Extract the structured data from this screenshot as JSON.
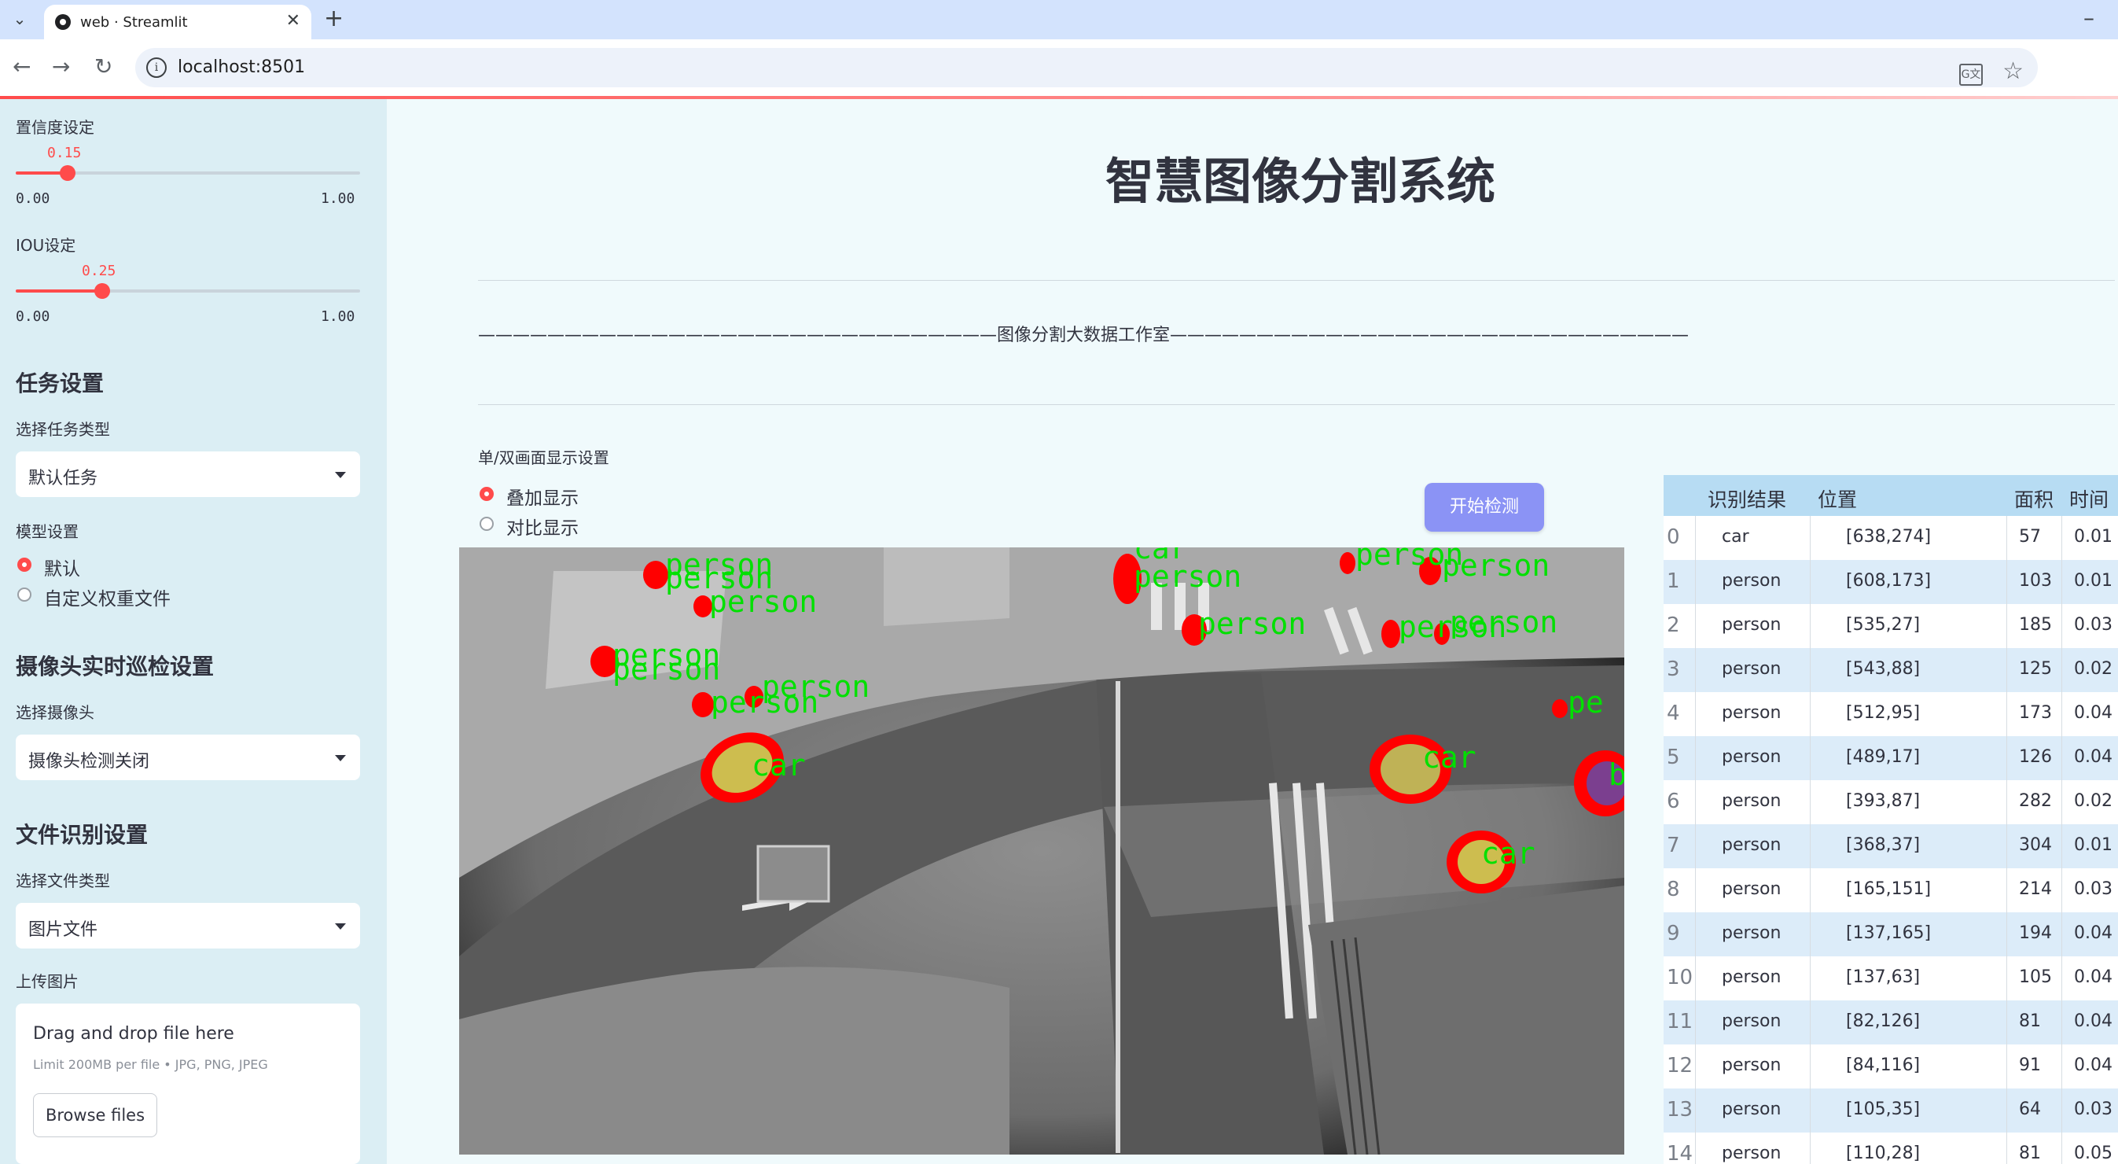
{
  "browser": {
    "tab_title": "web · Streamlit",
    "url": "localhost:8501"
  },
  "sidebar": {
    "confidence": {
      "label": "置信度设定",
      "value": "0.15",
      "value_num": 0.15,
      "min": "0.00",
      "max": "1.00"
    },
    "iou": {
      "label": "IOU设定",
      "value": "0.25",
      "value_num": 0.25,
      "min": "0.00",
      "max": "1.00"
    },
    "task_heading": "任务设置",
    "task_type_label": "选择任务类型",
    "task_type_value": "默认任务",
    "model_label": "模型设置",
    "model_options": [
      "默认",
      "自定义权重文件"
    ],
    "model_selected": "默认",
    "camera_heading": "摄像头实时巡检设置",
    "camera_label": "选择摄像头",
    "camera_value": "摄像头检测关闭",
    "file_heading": "文件识别设置",
    "file_type_label": "选择文件类型",
    "file_type_value": "图片文件",
    "upload_label": "上传图片",
    "uploader": {
      "main": "Drag and drop file here",
      "sub": "Limit 200MB per file • JPG, PNG, JPEG",
      "button": "Browse files"
    }
  },
  "main": {
    "title": "智慧图像分割系统",
    "banner": "——————————————————————————————图像分割大数据工作室——————————————————————————————",
    "display_mode_label": "单/双画面显示设置",
    "display_modes": [
      "叠加显示",
      "对比显示"
    ],
    "display_selected": "叠加显示",
    "start_button": "开始检测"
  },
  "detections_overlay": [
    "person",
    "person",
    "person",
    "person",
    "person",
    "person",
    "person",
    "person",
    "car",
    "person",
    "person",
    "pe",
    "car",
    "car",
    "b"
  ],
  "results_table": {
    "columns": [
      "识别结果",
      "位置",
      "面积",
      "时间"
    ],
    "rows": [
      {
        "idx": "0",
        "cls": "car",
        "pos": "[638,274]",
        "area": "57",
        "time": "0.01"
      },
      {
        "idx": "1",
        "cls": "person",
        "pos": "[608,173]",
        "area": "103",
        "time": "0.01"
      },
      {
        "idx": "2",
        "cls": "person",
        "pos": "[535,27]",
        "area": "185",
        "time": "0.03"
      },
      {
        "idx": "3",
        "cls": "person",
        "pos": "[543,88]",
        "area": "125",
        "time": "0.02"
      },
      {
        "idx": "4",
        "cls": "person",
        "pos": "[512,95]",
        "area": "173",
        "time": "0.04"
      },
      {
        "idx": "5",
        "cls": "person",
        "pos": "[489,17]",
        "area": "126",
        "time": "0.04"
      },
      {
        "idx": "6",
        "cls": "person",
        "pos": "[393,87]",
        "area": "282",
        "time": "0.02"
      },
      {
        "idx": "7",
        "cls": "person",
        "pos": "[368,37]",
        "area": "304",
        "time": "0.01"
      },
      {
        "idx": "8",
        "cls": "person",
        "pos": "[165,151]",
        "area": "214",
        "time": "0.03"
      },
      {
        "idx": "9",
        "cls": "person",
        "pos": "[137,165]",
        "area": "194",
        "time": "0.04"
      },
      {
        "idx": "10",
        "cls": "person",
        "pos": "[137,63]",
        "area": "105",
        "time": "0.04"
      },
      {
        "idx": "11",
        "cls": "person",
        "pos": "[82,126]",
        "area": "81",
        "time": "0.04"
      },
      {
        "idx": "12",
        "cls": "person",
        "pos": "[84,116]",
        "area": "91",
        "time": "0.04"
      },
      {
        "idx": "13",
        "cls": "person",
        "pos": "[105,35]",
        "area": "64",
        "time": "0.03"
      },
      {
        "idx": "14",
        "cls": "person",
        "pos": "[110,28]",
        "area": "81",
        "time": "0.05"
      }
    ]
  },
  "colors": {
    "accent": "#ff4b4b",
    "primary_button": "#8b93f5",
    "sidebar_bg": "#dbeef4",
    "table_header": "#b7dcf3",
    "table_stripe": "#dcecf9",
    "mask_outline": "#ff0000",
    "mask_fill": "#d4c24a",
    "label_text": "#00e000"
  }
}
